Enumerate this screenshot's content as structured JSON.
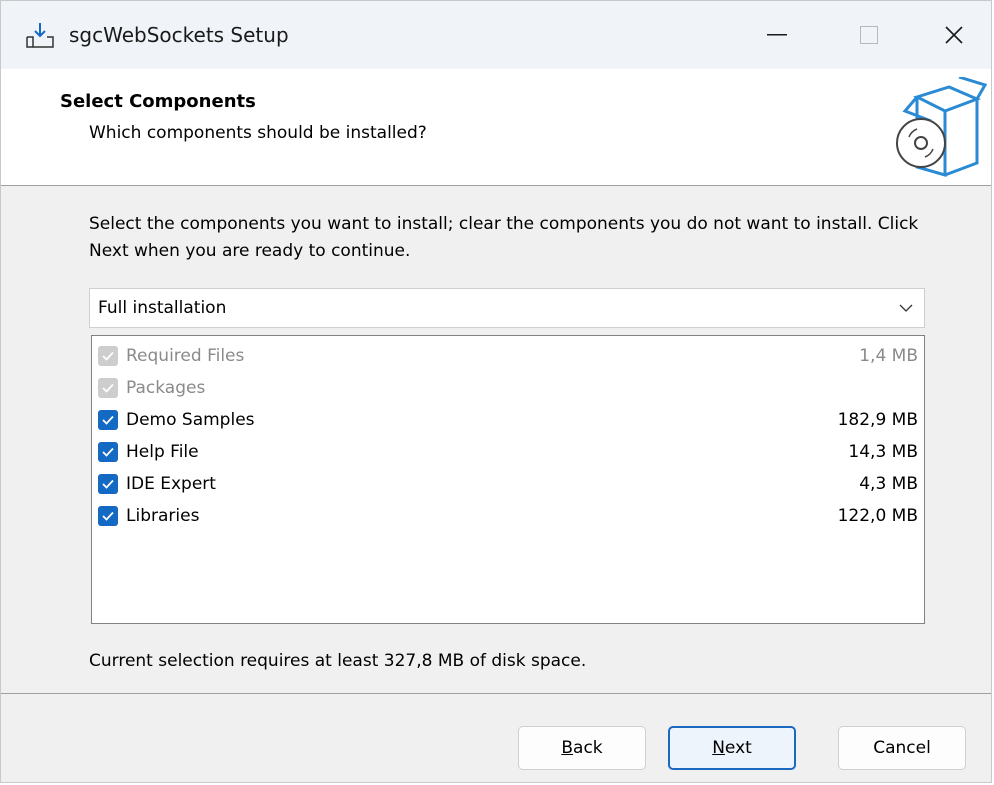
{
  "window": {
    "title": "sgcWebSockets Setup"
  },
  "header": {
    "title": "Select Components",
    "subtitle": "Which components should be installed?"
  },
  "body": {
    "instructions": "Select the components you want to install; clear the components you do not want to install. Click Next when you are ready to continue.",
    "install_type": "Full installation",
    "components": [
      {
        "name": "Required Files",
        "size": "1,4 MB",
        "checked": true,
        "disabled": true
      },
      {
        "name": "Packages",
        "size": "",
        "checked": true,
        "disabled": true
      },
      {
        "name": "Demo Samples",
        "size": "182,9 MB",
        "checked": true,
        "disabled": false
      },
      {
        "name": "Help File",
        "size": "14,3 MB",
        "checked": true,
        "disabled": false
      },
      {
        "name": "IDE Expert",
        "size": "4,3 MB",
        "checked": true,
        "disabled": false
      },
      {
        "name": "Libraries",
        "size": "122,0 MB",
        "checked": true,
        "disabled": false
      }
    ],
    "disk_space": "Current selection requires at least 327,8 MB of disk space."
  },
  "buttons": {
    "back_accel": "B",
    "back_rest": "ack",
    "next_accel": "N",
    "next_rest": "ext",
    "cancel": "Cancel"
  },
  "icons": {
    "app": "install-download-icon",
    "header": "software-box-cd-icon",
    "minimize": "minimize-icon",
    "maximize": "maximize-icon",
    "close": "close-icon",
    "dropdown": "chevron-down-icon",
    "checkbox": "checkmark-icon"
  },
  "colors": {
    "accent": "#1469c2",
    "disabled_check": "#cdcdcd",
    "titlebar": "#f0f4f9"
  }
}
